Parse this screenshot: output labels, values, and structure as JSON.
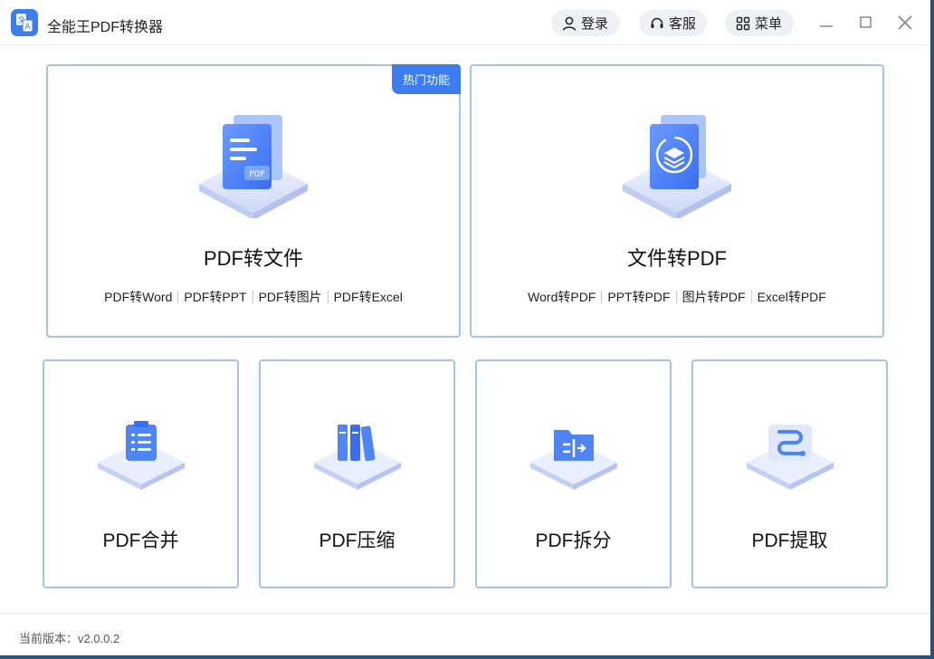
{
  "app": {
    "title": "全能王PDF转换器"
  },
  "header": {
    "login_label": "登录",
    "service_label": "客服",
    "menu_label": "菜单"
  },
  "cards": {
    "pdf_to_file": {
      "badge": "热门功能",
      "title": "PDF转文件",
      "links": [
        "PDF转Word",
        "PDF转PPT",
        "PDF转图片",
        "PDF转Excel"
      ]
    },
    "file_to_pdf": {
      "title": "文件转PDF",
      "links": [
        "Word转PDF",
        "PPT转PDF",
        "图片转PDF",
        "Excel转PDF"
      ]
    },
    "merge": {
      "title": "PDF合并"
    },
    "compress": {
      "title": "PDF压缩"
    },
    "split": {
      "title": "PDF拆分"
    },
    "extract": {
      "title": "PDF提取"
    }
  },
  "footer": {
    "version": "当前版本：v2.0.0.2"
  },
  "icons": {
    "logo": "translate-doc-icon",
    "login": "user-icon",
    "service": "headset-icon",
    "menu": "grid-icon",
    "pdf_to_file": "pdf-document-icon",
    "file_to_pdf": "layers-convert-icon",
    "merge": "clipboard-list-icon",
    "compress": "books-icon",
    "split": "split-folder-icon",
    "extract": "extract-path-icon"
  },
  "colors": {
    "accent": "#3b7cf0",
    "card_border": "#a9c2e6",
    "pill_bg": "#eef0f4"
  }
}
